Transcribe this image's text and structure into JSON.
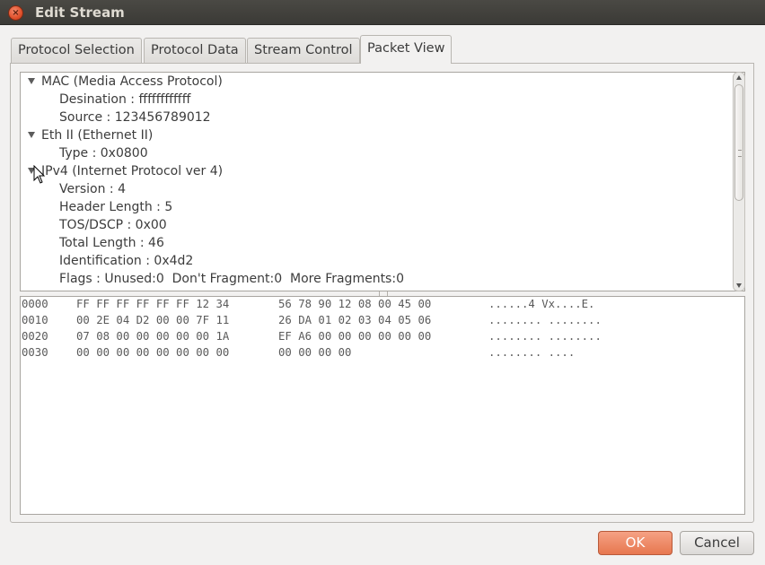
{
  "window": {
    "title": "Edit Stream",
    "close_symbol": "×"
  },
  "tabs": [
    {
      "label": "Protocol Selection",
      "active": false
    },
    {
      "label": "Protocol Data",
      "active": false
    },
    {
      "label": "Stream Control",
      "active": false
    },
    {
      "label": "Packet View",
      "active": true
    }
  ],
  "tree": {
    "items": [
      {
        "label": "MAC (Media Access Protocol)",
        "level": 0,
        "expanded": true
      },
      {
        "label": "Desination : ffffffffffff",
        "level": 1
      },
      {
        "label": "Source : 123456789012",
        "level": 1
      },
      {
        "label": "Eth II (Ethernet II)",
        "level": 0,
        "expanded": true
      },
      {
        "label": "Type : 0x0800",
        "level": 1
      },
      {
        "label": "IPv4 (Internet Protocol ver 4)",
        "level": 0,
        "expanded": true
      },
      {
        "label": "Version : 4",
        "level": 1
      },
      {
        "label": "Header Length : 5",
        "level": 1
      },
      {
        "label": "TOS/DSCP : 0x00",
        "level": 1
      },
      {
        "label": "Total Length : 46",
        "level": 1
      },
      {
        "label": "Identification : 0x4d2",
        "level": 1
      },
      {
        "label": "Flags : Unused:0  Don't Fragment:0  More Fragments:0",
        "level": 1
      }
    ]
  },
  "hex_dump": {
    "rows": [
      {
        "offset": "0000",
        "bytes1": "FF FF FF FF FF FF 12 34",
        "bytes2": "56 78 90 12 08 00 45 00",
        "ascii": "......4 Vx....E."
      },
      {
        "offset": "0010",
        "bytes1": "00 2E 04 D2 00 00 7F 11",
        "bytes2": "26 DA 01 02 03 04 05 06",
        "ascii": "........ ........"
      },
      {
        "offset": "0020",
        "bytes1": "07 08 00 00 00 00 00 1A",
        "bytes2": "EF A6 00 00 00 00 00 00",
        "ascii": "........ ........"
      },
      {
        "offset": "0030",
        "bytes1": "00 00 00 00 00 00 00 00",
        "bytes2": "00 00 00 00",
        "ascii": "........ ...."
      }
    ]
  },
  "buttons": {
    "ok": "OK",
    "cancel": "Cancel"
  },
  "colors": {
    "ok_accent": "#e7774f",
    "titlebar": "#3b3a36",
    "window_bg": "#f2f1f0"
  }
}
